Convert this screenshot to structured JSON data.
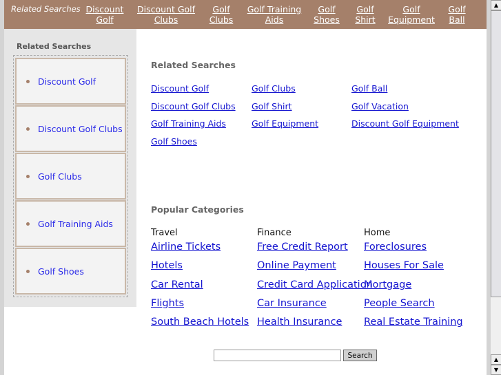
{
  "topnav": {
    "lead": "Related Searches",
    "items": [
      {
        "l1": "Discount",
        "l2": "Golf"
      },
      {
        "l1": "Discount Golf",
        "l2": "Clubs"
      },
      {
        "l1": "Golf",
        "l2": "Clubs"
      },
      {
        "l1": "Golf Training",
        "l2": "Aids"
      },
      {
        "l1": "Golf",
        "l2": "Shoes"
      },
      {
        "l1": "Golf",
        "l2": "Shirt"
      },
      {
        "l1": "Golf",
        "l2": "Equipment"
      },
      {
        "l1": "Golf",
        "l2": "Ball"
      }
    ]
  },
  "sidebar": {
    "title": "Related Searches",
    "items": [
      "Discount Golf",
      "Discount Golf Clubs",
      "Golf Clubs",
      "Golf Training Aids",
      "Golf Shoes"
    ]
  },
  "related": {
    "title": "Related Searches",
    "links": [
      "Discount Golf",
      "Golf Clubs",
      "Golf Ball",
      "Discount Golf Clubs",
      "Golf Shirt",
      "Golf Vacation",
      "Golf Training Aids",
      "Golf Equipment",
      "Discount Golf Equipment",
      "Golf Shoes"
    ]
  },
  "popular": {
    "title": "Popular Categories",
    "columns": [
      {
        "head": "Travel",
        "links": [
          "Airline Tickets",
          "Hotels",
          "Car Rental",
          "Flights",
          "South Beach Hotels"
        ]
      },
      {
        "head": "Finance",
        "links": [
          "Free Credit Report",
          "Online Payment",
          "Credit Card Application",
          "Car Insurance",
          "Health Insurance"
        ]
      },
      {
        "head": "Home",
        "links": [
          "Foreclosures",
          "Houses For Sale",
          "Mortgage",
          "People Search",
          "Real Estate Training"
        ]
      }
    ]
  },
  "search": {
    "value": "",
    "button": "Search"
  }
}
